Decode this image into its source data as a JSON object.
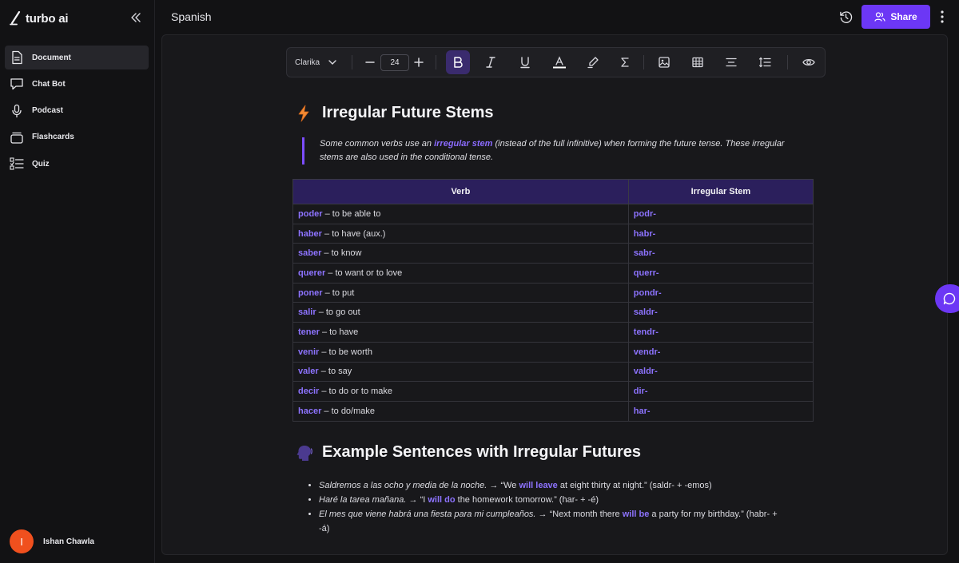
{
  "app": {
    "name": "turbo ai"
  },
  "sidebar": {
    "items": [
      {
        "label": "Document",
        "icon": "document-icon",
        "active": true
      },
      {
        "label": "Chat Bot",
        "icon": "chat-bubble-icon",
        "active": false
      },
      {
        "label": "Podcast",
        "icon": "microphone-icon",
        "active": false
      },
      {
        "label": "Flashcards",
        "icon": "flashcards-icon",
        "active": false
      },
      {
        "label": "Quiz",
        "icon": "quiz-list-icon",
        "active": false
      }
    ],
    "user": {
      "initial": "I",
      "name": "Ishan Chawla"
    }
  },
  "header": {
    "title": "Spanish",
    "share_label": "Share"
  },
  "toolbar": {
    "font": "Clarika",
    "font_size": "24"
  },
  "document": {
    "section1": {
      "heading": "Irregular Future Stems",
      "callout_before": "Some common verbs use an ",
      "callout_highlight": "irregular stem",
      "callout_after": " (instead of the full infinitive) when forming the future tense. These irregular stems are also used in the conditional tense."
    },
    "table": {
      "headers": [
        "Verb",
        "Irregular Stem"
      ],
      "rows": [
        {
          "verb": "poder",
          "meaning": " – to be able to",
          "stem": "podr-"
        },
        {
          "verb": "haber",
          "meaning": " – to have (aux.)",
          "stem": "habr-"
        },
        {
          "verb": "saber",
          "meaning": " – to know",
          "stem": "sabr-"
        },
        {
          "verb": "querer",
          "meaning": " – to want or to love",
          "stem": "querr-"
        },
        {
          "verb": "poner",
          "meaning": " – to put",
          "stem": "pondr-"
        },
        {
          "verb": "salir",
          "meaning": " – to go out",
          "stem": "saldr-"
        },
        {
          "verb": "tener",
          "meaning": " – to have",
          "stem": "tendr-"
        },
        {
          "verb": "venir",
          "meaning": " – to be worth",
          "stem": "vendr-"
        },
        {
          "verb": "valer",
          "meaning": " – to say",
          "stem": "valdr-"
        },
        {
          "verb": "decir",
          "meaning": " – to do or to make",
          "stem": "dir-"
        },
        {
          "verb": "hacer",
          "meaning": " – to do/make",
          "stem": "har-"
        }
      ]
    },
    "section2": {
      "heading": "Example Sentences with Irregular Futures",
      "examples": [
        {
          "es": "Saldremos a las ocho y media de la noche.",
          "arrow": " → “We ",
          "hl": "will leave",
          "rest": " at eight thirty at night.” (saldr- + -emos)"
        },
        {
          "es": "Haré la tarea mañana.",
          "arrow": " → “I ",
          "hl": "will do",
          "rest": " the homework tomorrow.” (har- + -é)"
        },
        {
          "es": "El mes que viene habrá una fiesta para mi cumpleaños.",
          "arrow": " → “Next month there ",
          "hl": "will be",
          "rest": " a party for my birthday.” (habr- + -á)"
        }
      ]
    }
  }
}
